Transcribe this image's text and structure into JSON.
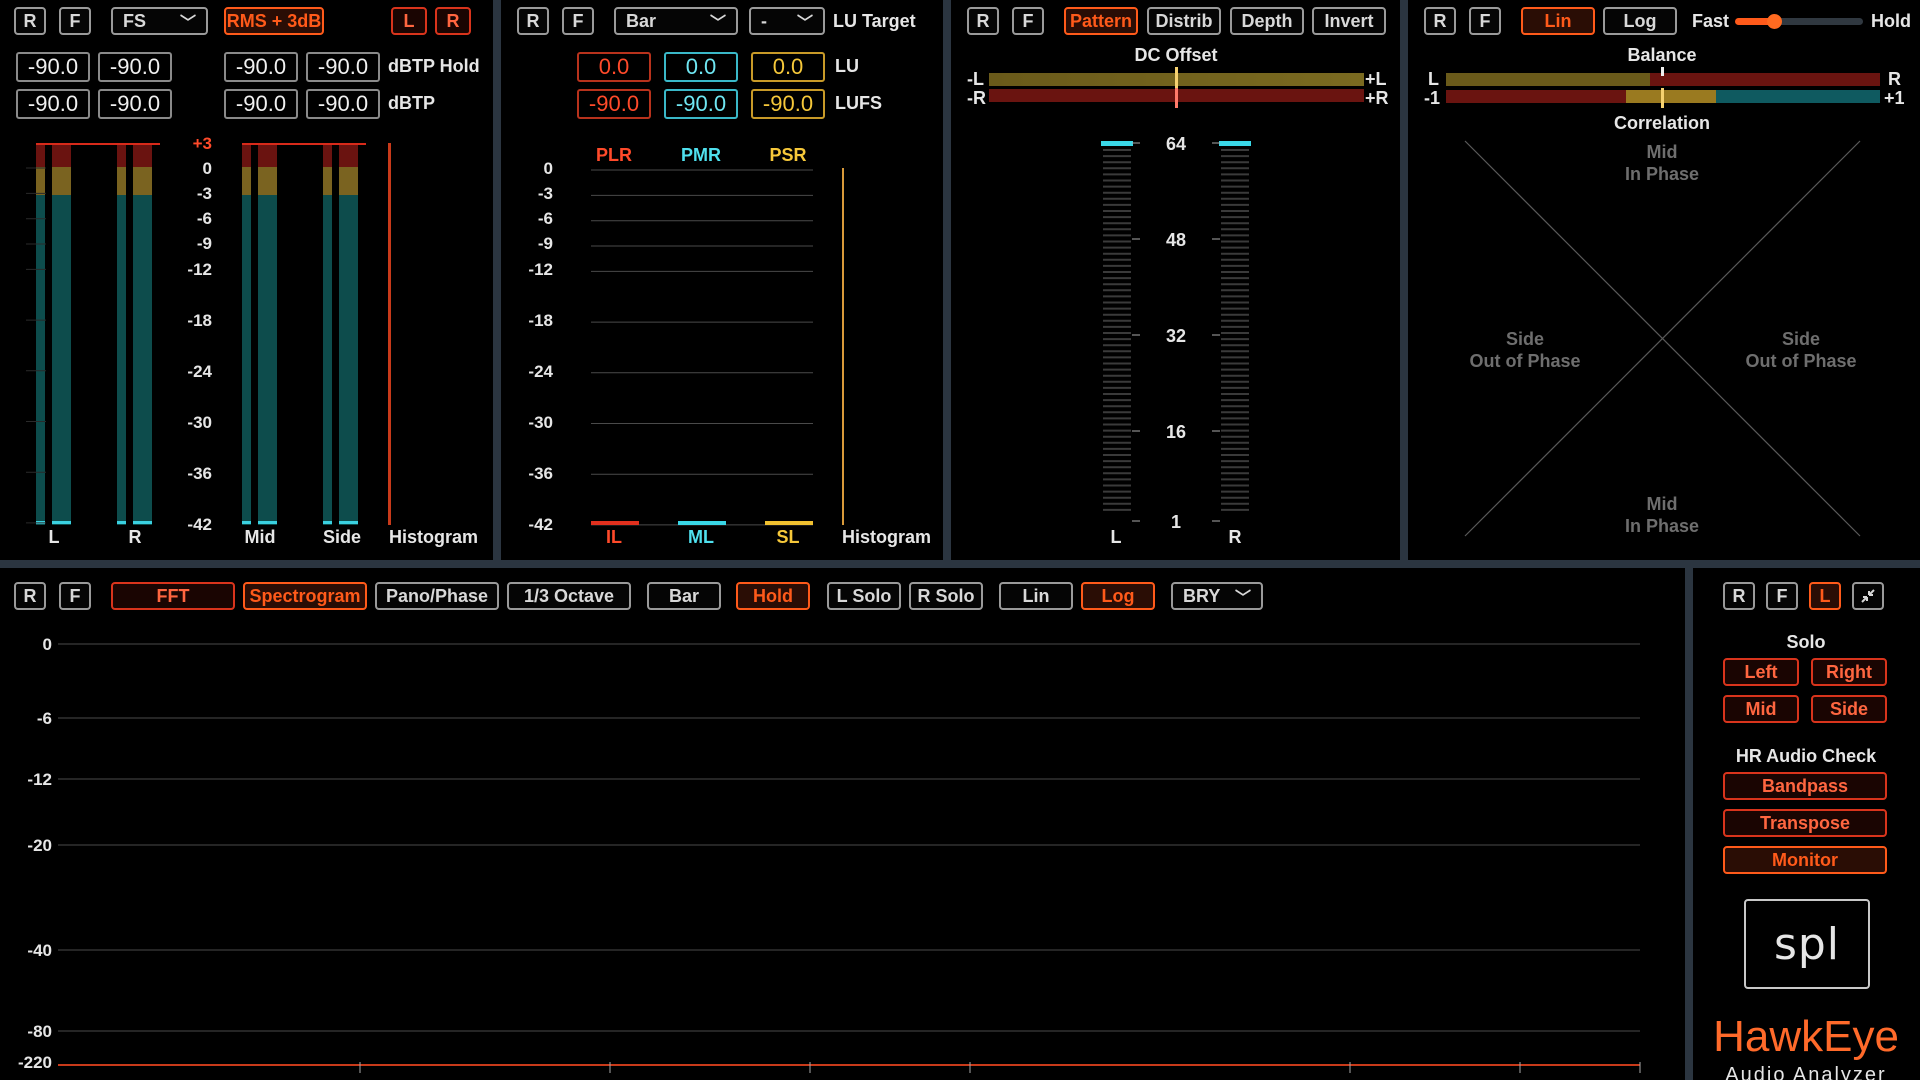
{
  "common": {
    "reset": "R",
    "freeze": "F"
  },
  "level": {
    "scale_dropdown": "FS",
    "rms_button": "RMS + 3dB",
    "left_button": "L",
    "right_button": "R",
    "readouts_row1": [
      "-90.0",
      "-90.0",
      "-90.0",
      "-90.0"
    ],
    "readouts_row2": [
      "-90.0",
      "-90.0",
      "-90.0",
      "-90.0"
    ],
    "row1_label": "dBTP Hold",
    "row2_label": "dBTP",
    "scale": [
      "+3",
      "0",
      "-3",
      "-6",
      "-9",
      "-12",
      "-18",
      "-24",
      "-30",
      "-36",
      "-42"
    ],
    "meter_labels": [
      "L",
      "R",
      "Mid",
      "Side"
    ],
    "histogram_label": "Histogram"
  },
  "loudness": {
    "view_dropdown": "Bar",
    "target_dropdown": "-",
    "target_label": "LU Target",
    "lu_values": [
      "0.0",
      "0.0",
      "0.0"
    ],
    "lu_label": "LU",
    "lufs_values": [
      "-90.0",
      "-90.0",
      "-90.0"
    ],
    "lufs_label": "LUFS",
    "top_labels": [
      "PLR",
      "PMR",
      "PSR"
    ],
    "bottom_labels": [
      "IL",
      "ML",
      "SL"
    ],
    "scale": [
      "0",
      "-3",
      "-6",
      "-9",
      "-12",
      "-18",
      "-24",
      "-30",
      "-36",
      "-42"
    ],
    "histogram_label": "Histogram",
    "colors": {
      "red": "#e0301e",
      "cyan": "#39d6e6",
      "yellow": "#f0c030"
    }
  },
  "bits": {
    "buttons": [
      "Pattern",
      "Distrib",
      "Depth",
      "Invert"
    ],
    "dc_title": "DC Offset",
    "dc_left_neg": "-L",
    "dc_left_pos": "+L",
    "dc_right_neg": "-R",
    "dc_right_pos": "+R",
    "scale": [
      "64",
      "48",
      "32",
      "16",
      "1"
    ],
    "meter_labels": [
      "L",
      "R"
    ]
  },
  "stereo": {
    "lin": "Lin",
    "log": "Log",
    "fast": "Fast",
    "hold": "Hold",
    "balance_title": "Balance",
    "balance_l": "L",
    "balance_r": "R",
    "corr_neg": "-1",
    "corr_pos": "+1",
    "corr_title": "Correlation",
    "mid_top_1": "Mid",
    "mid_top_2": "In Phase",
    "side_left_1": "Side",
    "side_left_2": "Out of Phase",
    "side_right_1": "Side",
    "side_right_2": "Out of Phase",
    "mid_bottom_1": "Mid",
    "mid_bottom_2": "In Phase"
  },
  "spectrum": {
    "buttons": [
      "FFT",
      "Spectrogram",
      "Pano/Phase",
      "1/3 Octave",
      "Bar",
      "Hold",
      "L Solo",
      "R Solo",
      "Lin",
      "Log"
    ],
    "palette_dropdown": "BRY",
    "y_ticks": [
      "0",
      "-6",
      "-12",
      "-20",
      "-40",
      "-80",
      "-220"
    ]
  },
  "side_panel": {
    "left_toggle": "L",
    "solo_title": "Solo",
    "solo_buttons": [
      "Left",
      "Right",
      "Mid",
      "Side"
    ],
    "hr_title": "HR Audio Check",
    "hr_buttons": [
      "Bandpass",
      "Transpose",
      "Monitor"
    ],
    "logo_text": "spl",
    "product_name": "HawkEye",
    "product_sub": "Audio Analyzer"
  }
}
